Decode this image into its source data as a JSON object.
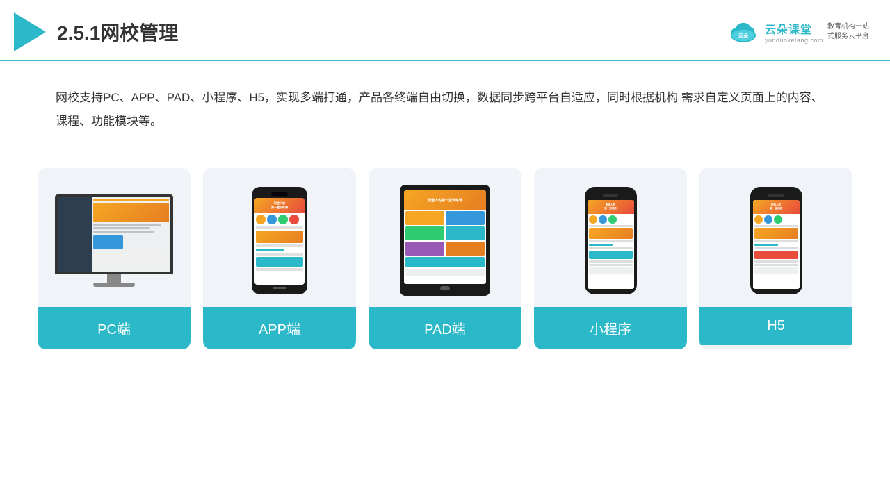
{
  "header": {
    "title": "2.5.1网校管理",
    "brand": {
      "name": "云朵课堂",
      "url": "yunduoketang.com",
      "slogan": "教育机构一站\n式服务云平台"
    }
  },
  "description": "网校支持PC、APP、PAD、小程序、H5，实现多端打通，产品各终端自由切换，数据同步跨平台自适应，同时根据机构\n需求自定义页面上的内容、课程、功能模块等。",
  "cards": [
    {
      "id": "pc",
      "label": "PC端"
    },
    {
      "id": "app",
      "label": "APP端"
    },
    {
      "id": "pad",
      "label": "PAD端"
    },
    {
      "id": "miniprogram",
      "label": "小程序"
    },
    {
      "id": "h5",
      "label": "H5"
    }
  ]
}
